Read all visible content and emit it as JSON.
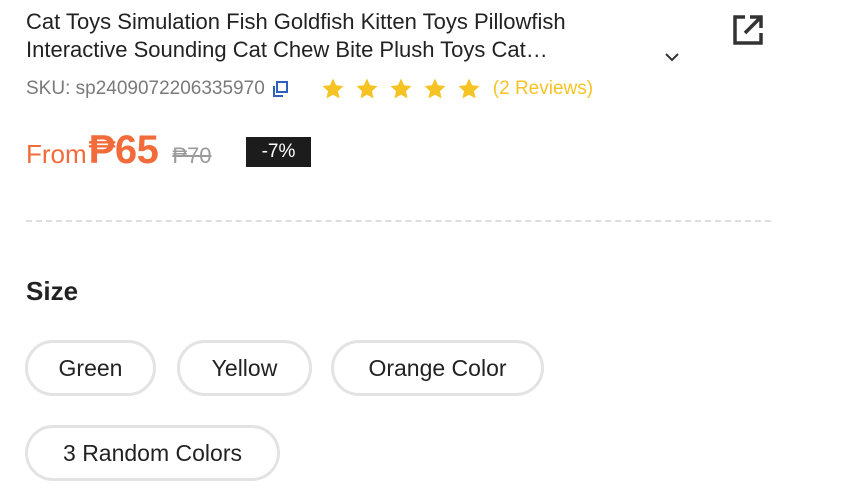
{
  "product": {
    "title_line1": "Cat Toys Simulation Fish Goldfish Kitten Toys Pillowfish",
    "title_line2": "Interactive Sounding Cat Chew Bite Plush Toys Cat…",
    "sku": "SKU: sp2409072206335970",
    "rating_stars": 5,
    "reviews": "(2 Reviews)"
  },
  "price": {
    "prefix": "From",
    "current": "₱65",
    "original": "₱70",
    "discount": "-7%"
  },
  "size": {
    "label": "Size",
    "options": [
      "Green",
      "Yellow",
      "Orange Color",
      "3 Random Colors"
    ]
  },
  "colors": {
    "price": "#f26b3a",
    "star": "#f6c325",
    "badge_bg": "#1c1c1c",
    "copy_icon": "#2f5fbf"
  },
  "icons": {
    "expand": "chevron-down-icon",
    "share": "external-link-icon",
    "copy": "copy-icon",
    "star": "star-icon"
  }
}
